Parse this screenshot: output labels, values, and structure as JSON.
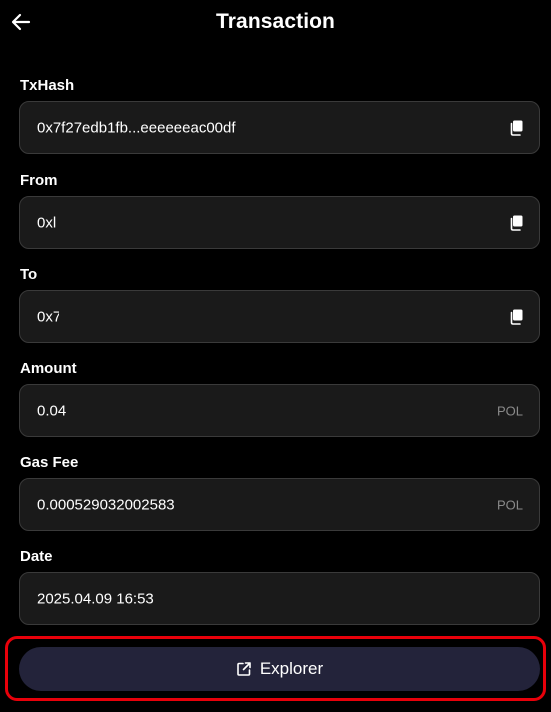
{
  "header": {
    "title": "Transaction",
    "back_icon": "arrow-left-icon"
  },
  "fields": {
    "txhash": {
      "label": "TxHash",
      "value": "0x7f27edb1fb...eeeeeeac00df",
      "icon": "copy-icon"
    },
    "from": {
      "label": "From",
      "value": "0xl",
      "icon": "copy-icon"
    },
    "to": {
      "label": "To",
      "value": "0x7",
      "icon": "copy-icon"
    },
    "amount": {
      "label": "Amount",
      "value": "0.04",
      "unit": "POL"
    },
    "gas_fee": {
      "label": "Gas Fee",
      "value": "0.000529032002583",
      "unit": "POL"
    },
    "date": {
      "label": "Date",
      "value": "2025.04.09 16:53"
    }
  },
  "explorer": {
    "label": "Explorer",
    "icon": "external-link-icon"
  },
  "colors": {
    "background": "#000000",
    "field_background": "#1a1a1a",
    "field_border": "#3a3a3a",
    "button_background": "#23233a",
    "highlight": "#e8000a",
    "unit_text": "#8a8a8a"
  }
}
